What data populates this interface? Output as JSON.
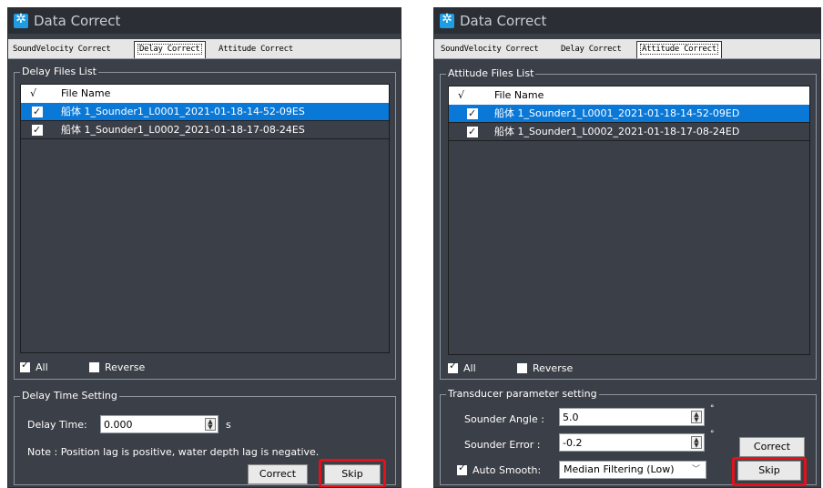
{
  "window_title": "Data Correct",
  "tabs": [
    "SoundVelocity Correct",
    "Delay Correct",
    "Attitude Correct"
  ],
  "left": {
    "active_tab": "Delay Correct",
    "files_group_title": "Delay Files List",
    "list_header": {
      "check": "√",
      "file_name": "File Name"
    },
    "files": [
      {
        "name": "船体 1_Sounder1_L0001_2021-01-18-14-52-09ES",
        "checked": true,
        "selected": true
      },
      {
        "name": "船体 1_Sounder1_L0002_2021-01-18-17-08-24ES",
        "checked": true,
        "selected": false
      }
    ],
    "all_label": "All",
    "all_checked": true,
    "reverse_label": "Reverse",
    "reverse_checked": false,
    "setting_group_title": "Delay Time Setting",
    "delay_time_label": "Delay Time:",
    "delay_time_value": "0.000",
    "delay_time_unit": "s",
    "note": "Note : Position lag is positive, water depth lag is negative.",
    "correct_button": "Correct",
    "skip_button": "Skip"
  },
  "right": {
    "active_tab": "Attitude Correct",
    "files_group_title": "Attitude Files List",
    "list_header": {
      "check": "√",
      "file_name": "File Name"
    },
    "files": [
      {
        "name": "船体 1_Sounder1_L0001_2021-01-18-14-52-09ED",
        "checked": true,
        "selected": true
      },
      {
        "name": "船体 1_Sounder1_L0002_2021-01-18-17-08-24ED",
        "checked": true,
        "selected": false
      }
    ],
    "all_label": "All",
    "all_checked": true,
    "reverse_label": "Reverse",
    "reverse_checked": false,
    "setting_group_title": "Transducer parameter setting",
    "sounder_angle_label": "Sounder Angle :",
    "sounder_angle_value": "5.0",
    "sounder_error_label": "Sounder Error :",
    "sounder_error_value": "-0.2",
    "degree_unit": "°",
    "auto_smooth_label": "Auto Smooth:",
    "auto_smooth_checked": true,
    "auto_smooth_value": "Median Filtering (Low)",
    "correct_button": "Correct",
    "skip_button": "Skip"
  },
  "colors": {
    "panel_bg": "#3b3f47",
    "title_bg": "#2b2e34",
    "selection": "#0a78d7",
    "highlight_box": "#e0121b",
    "app_icon": "#1e9ce4"
  },
  "icons": [
    "app-icon",
    "spin-arrows-icon",
    "dropdown-caret-icon",
    "checkbox-icon"
  ]
}
